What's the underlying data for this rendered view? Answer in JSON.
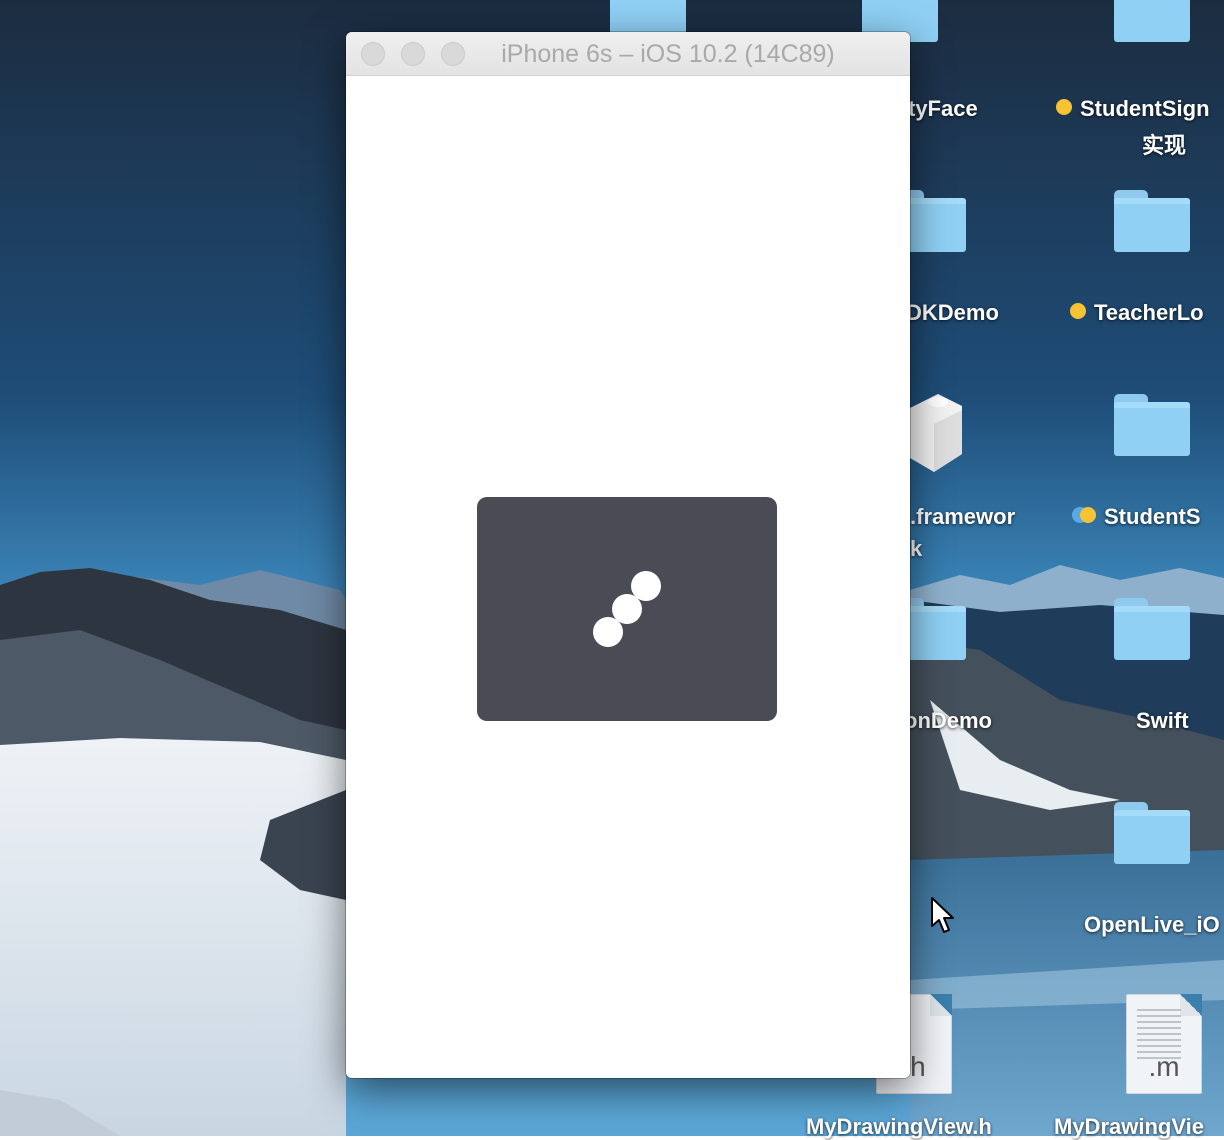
{
  "simulator": {
    "title": "iPhone 6s – iOS 10.2 (14C89)"
  },
  "desktop": {
    "labels": {
      "face": "tyFace",
      "student_sign_line1": "StudentSign",
      "student_sign_line2": "实现",
      "sdk_demo": "DKDemo",
      "teacher": "TeacherLo",
      "framework_line1": ".framewor",
      "framework_line2": "k",
      "student_s": "StudentS",
      "on_demo": "onDemo",
      "swift": "Swift",
      "openlive": "OpenLive_iO",
      "header_file": "MyDrawingView.h",
      "impl_file": "MyDrawingVie"
    },
    "file_ext": {
      "h": ".h",
      "m": ".m"
    },
    "tag_colors": {
      "yellow": "#f7c234",
      "blue": "#5aa9e6"
    }
  },
  "colors": {
    "hud": "#4b4b55",
    "folder": "#8fd0f4"
  }
}
